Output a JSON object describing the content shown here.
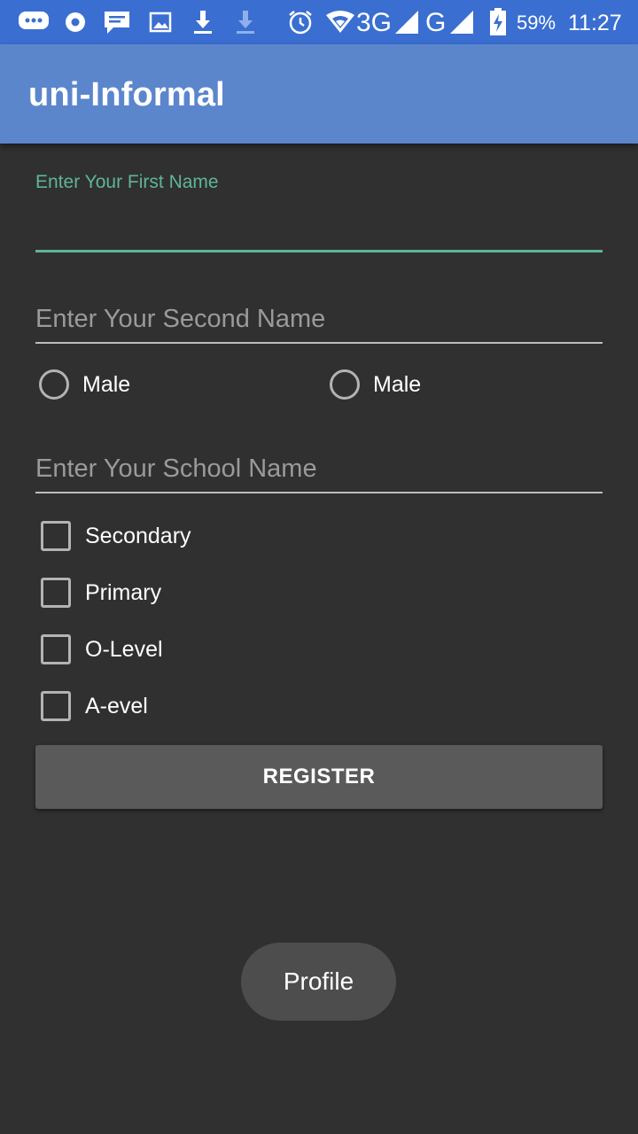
{
  "status_bar": {
    "signal_3g": "3G",
    "signal_g": "G",
    "battery": "59%",
    "time": "11:27",
    "icons": [
      "chat-bubble-icon",
      "circle-notification-icon",
      "message-icon",
      "image-icon",
      "download-icon",
      "download-faded-icon",
      "alarm-icon",
      "wifi-signal-icon",
      "cell-signal-icon",
      "cell-signal-icon",
      "battery-charging-icon"
    ]
  },
  "app_bar": {
    "title": "uni-Informal"
  },
  "form": {
    "first_name_label": "Enter Your First Name",
    "first_name_value": "",
    "second_name_placeholder": "Enter Your Second Name",
    "gender_options": [
      "Male",
      "Male"
    ],
    "school_name_placeholder": "Enter Your School Name",
    "levels": [
      "Secondary",
      "Primary",
      "O-Level",
      "A-evel"
    ],
    "register_label": "REGISTER"
  },
  "profile_label": "Profile",
  "colors": {
    "status_bar": "#3a6fd1",
    "app_bar": "#5b86cc",
    "background": "#303030",
    "accent": "#5fb597"
  }
}
